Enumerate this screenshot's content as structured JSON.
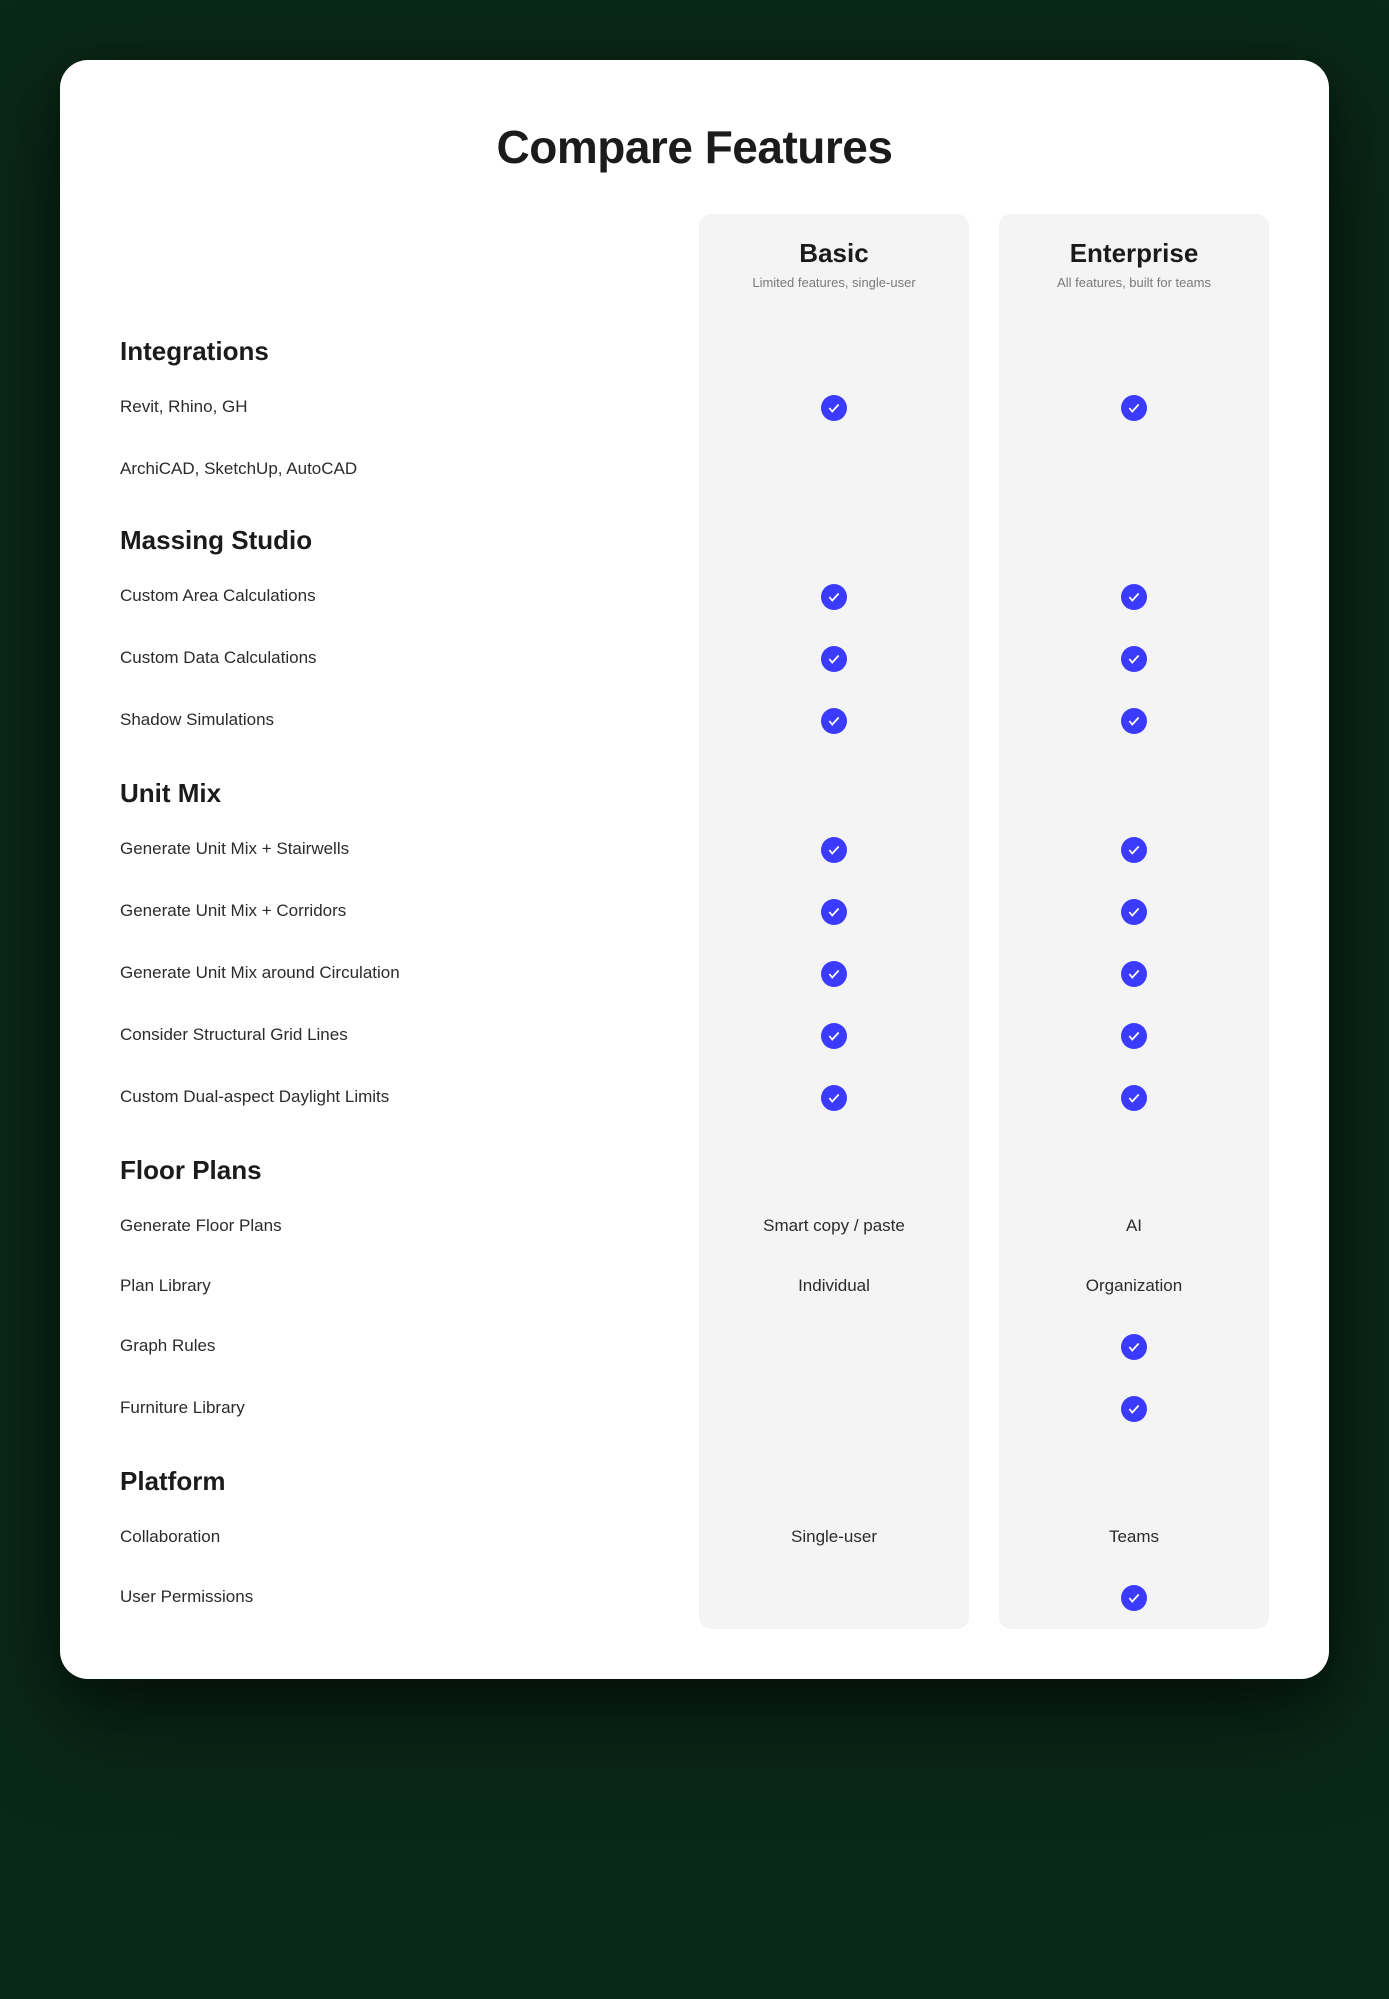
{
  "title": "Compare Features",
  "plans": {
    "basic": {
      "name": "Basic",
      "sub": "Limited features, single-user"
    },
    "enterprise": {
      "name": "Enterprise",
      "sub": "All features, built for teams"
    }
  },
  "sections": [
    {
      "name": "Integrations",
      "rows": [
        {
          "label": "Revit, Rhino, GH",
          "basic": "check",
          "enterprise": "check"
        },
        {
          "label": "ArchiCAD, SketchUp, AutoCAD",
          "basic": "",
          "enterprise": ""
        }
      ]
    },
    {
      "name": "Massing Studio",
      "rows": [
        {
          "label": "Custom Area Calculations",
          "basic": "check",
          "enterprise": "check"
        },
        {
          "label": "Custom Data Calculations",
          "basic": "check",
          "enterprise": "check"
        },
        {
          "label": "Shadow Simulations",
          "basic": "check",
          "enterprise": "check"
        }
      ]
    },
    {
      "name": "Unit Mix",
      "rows": [
        {
          "label": "Generate Unit Mix + Stairwells",
          "basic": "check",
          "enterprise": "check"
        },
        {
          "label": "Generate Unit Mix + Corridors",
          "basic": "check",
          "enterprise": "check"
        },
        {
          "label": "Generate Unit Mix around Circulation",
          "basic": "check",
          "enterprise": "check"
        },
        {
          "label": "Consider Structural Grid Lines",
          "basic": "check",
          "enterprise": "check"
        },
        {
          "label": "Custom Dual-aspect Daylight Limits",
          "basic": "check",
          "enterprise": "check"
        }
      ]
    },
    {
      "name": "Floor Plans",
      "rows": [
        {
          "label": "Generate Floor Plans",
          "basic": "Smart copy / paste",
          "enterprise": "AI"
        },
        {
          "label": "Plan Library",
          "basic": "Individual",
          "enterprise": "Organization"
        },
        {
          "label": "Graph Rules",
          "basic": "",
          "enterprise": "check"
        },
        {
          "label": "Furniture Library",
          "basic": "",
          "enterprise": "check"
        }
      ]
    },
    {
      "name": "Platform",
      "rows": [
        {
          "label": "Collaboration",
          "basic": "Single-user",
          "enterprise": "Teams"
        },
        {
          "label": "User Permissions",
          "basic": "",
          "enterprise": "check"
        }
      ]
    }
  ]
}
